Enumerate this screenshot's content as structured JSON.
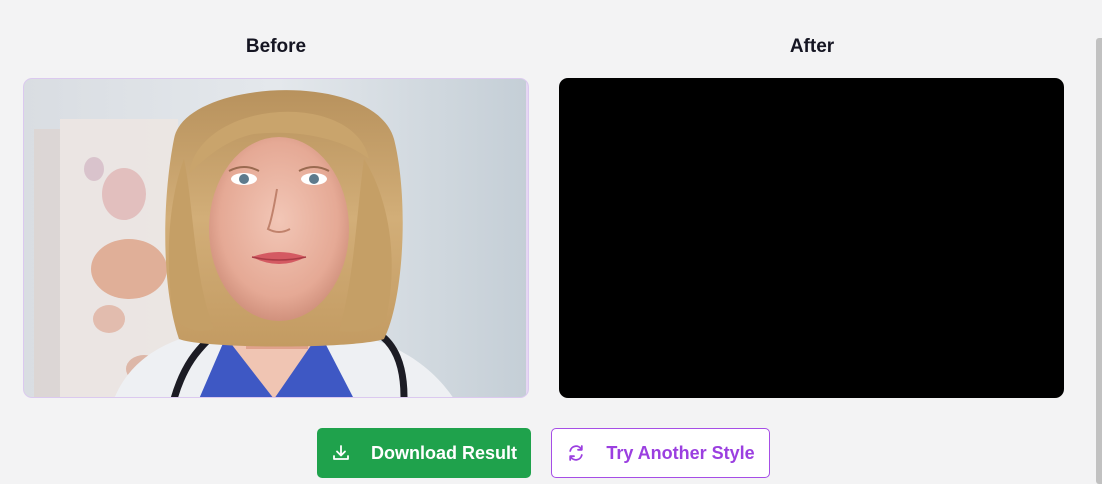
{
  "comparison": {
    "before_title": "Before",
    "after_title": "After"
  },
  "actions": {
    "download_label": "Download Result",
    "try_another_label": "Try Another Style"
  },
  "icons": {
    "download": "download-icon",
    "refresh": "refresh-icon"
  },
  "colors": {
    "download_bg": "#1fa24c",
    "try_another_accent": "#9b3fe0",
    "after_frame_bg": "#000000"
  }
}
